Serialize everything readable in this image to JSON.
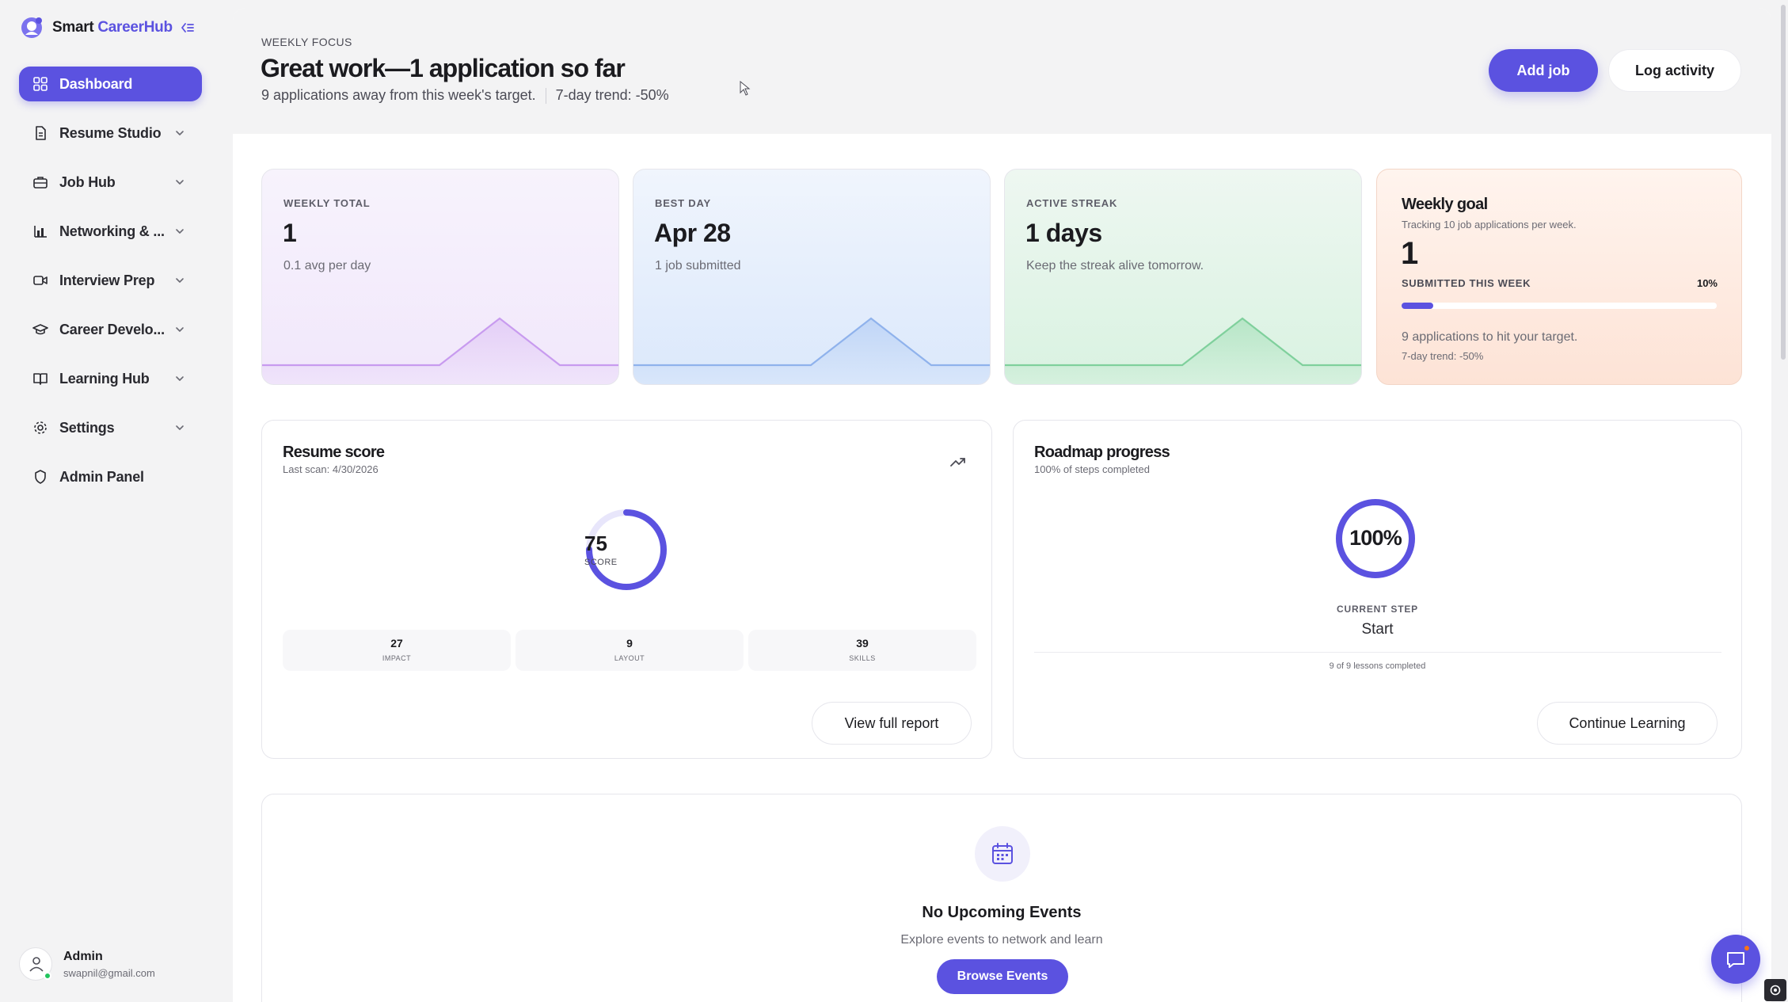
{
  "brand": {
    "name_part1": "Smart ",
    "name_part2": "CareerHub",
    "accent": "#5b52e0"
  },
  "sidebar": {
    "items": [
      {
        "label": "Dashboard",
        "icon": "grid-icon",
        "active": true
      },
      {
        "label": "Resume Studio",
        "icon": "document-icon"
      },
      {
        "label": "Job Hub",
        "icon": "briefcase-icon"
      },
      {
        "label": "Networking & ...",
        "icon": "bar-chart-icon"
      },
      {
        "label": "Interview Prep",
        "icon": "video-icon"
      },
      {
        "label": "Career Develo...",
        "icon": "graduation-cap-icon"
      },
      {
        "label": "Learning Hub",
        "icon": "book-icon"
      },
      {
        "label": "Settings",
        "icon": "gear-icon"
      },
      {
        "label": "Admin Panel",
        "icon": "shield-icon"
      }
    ]
  },
  "user": {
    "name": "Admin",
    "email": "swapnil@gmail.com"
  },
  "focus": {
    "kicker": "WEEKLY FOCUS",
    "title": "Great work—1 application so far",
    "subtitle": "9 applications away from this week's target.",
    "trend": "7-day trend: -50%",
    "add_job": "Add job",
    "log_activity": "Log activity"
  },
  "stats": {
    "weekly_total": {
      "kicker": "WEEKLY TOTAL",
      "value": "1",
      "note": "0.1 avg per day"
    },
    "best_day": {
      "kicker": "BEST DAY",
      "value": "Apr 28",
      "note": "1 job submitted"
    },
    "active_streak": {
      "kicker": "ACTIVE STREAK",
      "value": "1 days",
      "note": "Keep the streak alive tomorrow."
    }
  },
  "goal": {
    "title": "Weekly goal",
    "subtitle": "Tracking 10 job applications per week.",
    "value": "1",
    "label": "SUBMITTED THIS WEEK",
    "percent_text": "10%",
    "progress": 0.1,
    "note": "9 applications to hit your target.",
    "trend": "7-day trend: -50%"
  },
  "resume": {
    "title": "Resume score",
    "last_scan": "Last scan: 4/30/2026",
    "score": "75",
    "score_fraction": 0.75,
    "score_label": "SCORE",
    "metrics": [
      {
        "value": "27",
        "label": "IMPACT"
      },
      {
        "value": "9",
        "label": "LAYOUT"
      },
      {
        "value": "39",
        "label": "SKILLS"
      }
    ],
    "button": "View full report"
  },
  "roadmap": {
    "title": "Roadmap progress",
    "subtitle": "100% of steps completed",
    "percent": "100%",
    "progress": 1.0,
    "current_step_label": "CURRENT STEP",
    "current_step": "Start",
    "lessons": "9 of 9 lessons completed",
    "button": "Continue Learning"
  },
  "events": {
    "title": "No Upcoming Events",
    "subtitle": "Explore events to network and learn",
    "button": "Browse Events"
  }
}
